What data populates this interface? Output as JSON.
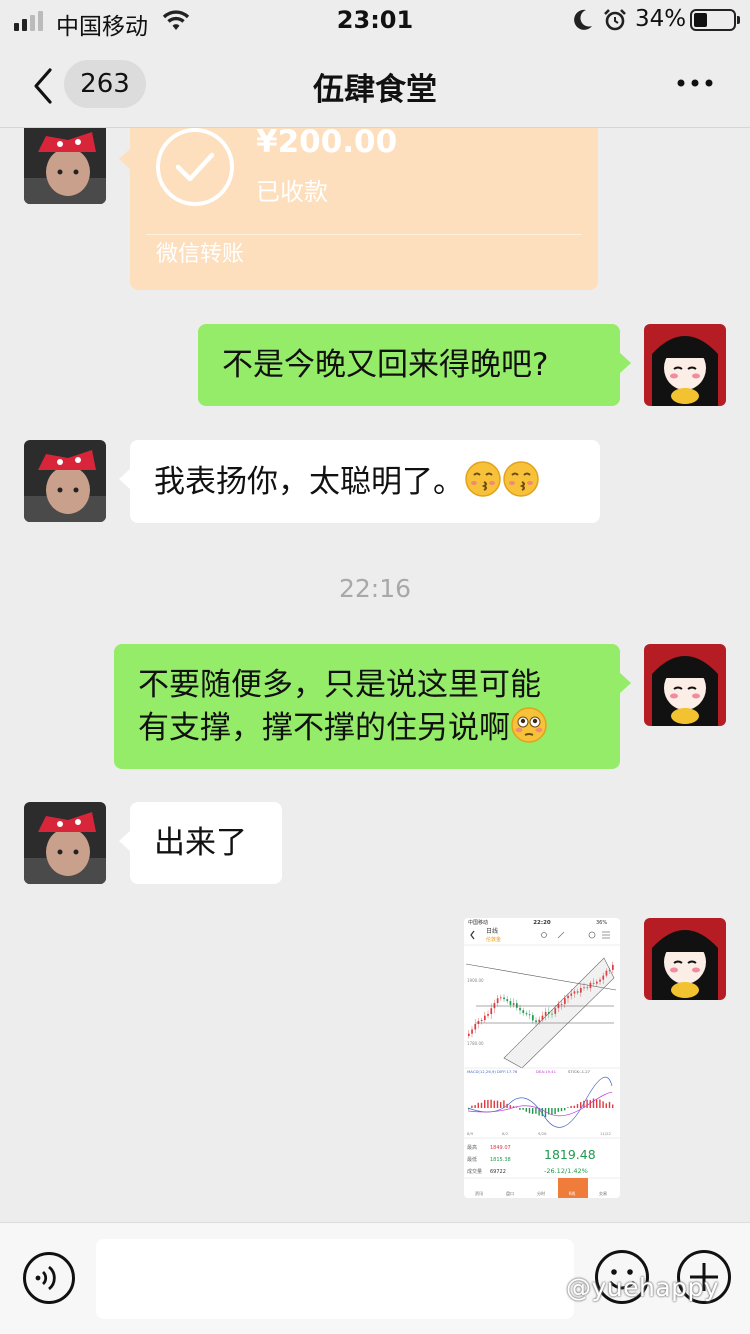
{
  "status_bar": {
    "carrier": "中国移动",
    "time": "23:01",
    "battery_percent": "34%",
    "battery_level": 0.34
  },
  "nav": {
    "unread_count": "263",
    "title": "伍肆食堂"
  },
  "messages": {
    "transfer": {
      "amount": "¥200.00",
      "status": "已收款",
      "label": "微信转账"
    },
    "m1": "不是今晚又回来得晚吧?",
    "m2": "我表扬你，太聪明了。",
    "timestamp": "22:16",
    "m3_line1": "不要随便多，只是说这里可能",
    "m3_line2": "有支撑，撑不撑的住另说啊",
    "m4": "出来了"
  },
  "screenshot": {
    "status_carrier": "中国移动",
    "status_time": "22:20",
    "status_battery": "36%",
    "tab_label": "日线",
    "instrument": "伦敦金",
    "price_upper": "1900.00",
    "price_lower": "1780.00",
    "indicator_macd": "MACD(12,26,9) DIFF:17.76",
    "indicator_dea": "DEA:19.41",
    "indicator_stick": "STICK:-1.27",
    "axis_labels": [
      "8/9",
      "8/2",
      "9/28",
      "11/22"
    ],
    "high_label": "最高",
    "high_value": "1849.07",
    "low_label": "最低",
    "low_value": "1815.38",
    "volume_label": "成交量",
    "volume_value": "69722",
    "last_price": "1819.48",
    "change": "-26.12/1.42%",
    "bottom_tabs": [
      "资讯",
      "盘口",
      "分时",
      "K线",
      "交易"
    ]
  },
  "input": {
    "placeholder": ""
  },
  "watermark": "@yuehappy",
  "colors": {
    "self_bubble": "#95ec69",
    "other_bubble": "#ffffff",
    "transfer_bubble": "#fddfbd",
    "chat_background": "#ededed",
    "kline_up": "#e0393e",
    "kline_down": "#1f9a4d"
  }
}
